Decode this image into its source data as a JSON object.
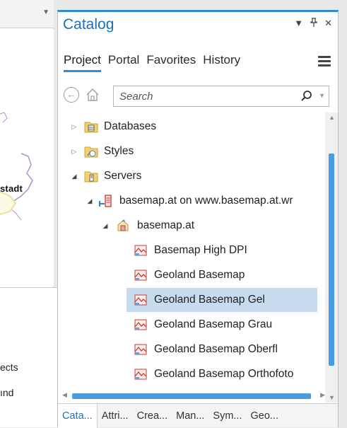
{
  "map": {
    "label": "stadt",
    "contents_items": [
      "ects",
      "ınd"
    ]
  },
  "catalog": {
    "title": "Catalog",
    "window_controls": [
      "▾",
      "ᵖ",
      "✕"
    ],
    "tabs": [
      {
        "label": "Project",
        "active": true
      },
      {
        "label": "Portal",
        "active": false
      },
      {
        "label": "Favorites",
        "active": false
      },
      {
        "label": "History",
        "active": false
      }
    ],
    "search": {
      "placeholder": "Search",
      "value": ""
    },
    "tree": [
      {
        "label": "Databases",
        "expanded": false,
        "icon": "database-folder-icon",
        "level": 0
      },
      {
        "label": "Styles",
        "expanded": false,
        "icon": "styles-folder-icon",
        "level": 0
      },
      {
        "label": "Servers",
        "expanded": true,
        "icon": "servers-folder-icon",
        "level": 0
      },
      {
        "label": "basemap.at on www.basemap.at.wr",
        "expanded": true,
        "icon": "server-connection-icon",
        "level": 1
      },
      {
        "label": "basemap.at",
        "expanded": true,
        "icon": "service-folder-icon",
        "level": 2
      },
      {
        "label": "Basemap High DPI",
        "icon": "map-layer-icon",
        "level": 3
      },
      {
        "label": "Geoland Basemap",
        "icon": "map-layer-icon",
        "level": 3
      },
      {
        "label": "Geoland Basemap Gel",
        "icon": "map-layer-icon",
        "level": 3,
        "selected": true
      },
      {
        "label": "Geoland Basemap Grau",
        "icon": "map-layer-icon",
        "level": 3
      },
      {
        "label": "Geoland Basemap Oberfl",
        "icon": "map-layer-icon",
        "level": 3
      },
      {
        "label": "Geoland Basemap Orthofoto",
        "icon": "map-layer-icon",
        "level": 3
      }
    ],
    "bottom_tabs": [
      {
        "label": "Cata...",
        "active": true
      },
      {
        "label": "Attri...",
        "active": false
      },
      {
        "label": "Crea...",
        "active": false
      },
      {
        "label": "Man...",
        "active": false
      },
      {
        "label": "Sym...",
        "active": false
      },
      {
        "label": "Geo...",
        "active": false
      }
    ],
    "accent_color": "#2f8bd2",
    "selection_color": "#c7dcee"
  }
}
